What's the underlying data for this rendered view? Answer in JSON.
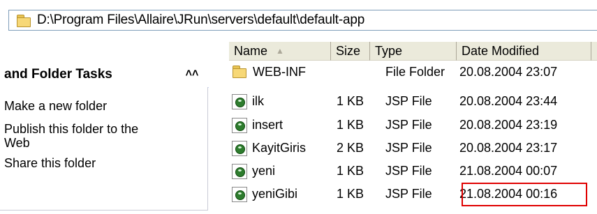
{
  "address_bar": {
    "path": "D:\\Program Files\\Allaire\\JRun\\servers\\default\\default-app",
    "icon": "folder-icon"
  },
  "task_pane": {
    "title": "and Folder Tasks",
    "collapse_glyph": "»",
    "items": [
      {
        "label": "Make a new folder"
      },
      {
        "label": "Publish this folder to the\nWeb"
      },
      {
        "label": "Share this folder"
      }
    ]
  },
  "file_list": {
    "columns": [
      {
        "label": "Name",
        "sorted": "ascending"
      },
      {
        "label": "Size"
      },
      {
        "label": "Type"
      },
      {
        "label": "Date Modified"
      }
    ],
    "rows": [
      {
        "name": "WEB-INF",
        "size": "",
        "type": "File Folder",
        "date": "20.08.2004 23:07",
        "icon": "folder-icon"
      },
      {
        "name": "ilk",
        "size": "1 KB",
        "type": "JSP File",
        "date": "20.08.2004 23:44",
        "icon": "jsp-file-icon"
      },
      {
        "name": "insert",
        "size": "1 KB",
        "type": "JSP File",
        "date": "20.08.2004 23:19",
        "icon": "jsp-file-icon"
      },
      {
        "name": "KayitGiris",
        "size": "2 KB",
        "type": "JSP File",
        "date": "20.08.2004 23:17",
        "icon": "jsp-file-icon"
      },
      {
        "name": "yeni",
        "size": "1 KB",
        "type": "JSP File",
        "date": "21.08.2004 00:07",
        "icon": "jsp-file-icon"
      },
      {
        "name": "yeniGibi",
        "size": "1 KB",
        "type": "JSP File",
        "date": "21.08.2004 00:16",
        "icon": "jsp-file-icon"
      }
    ]
  },
  "colors": {
    "highlight": "#e00000",
    "header_bg": "#ebeadb"
  }
}
